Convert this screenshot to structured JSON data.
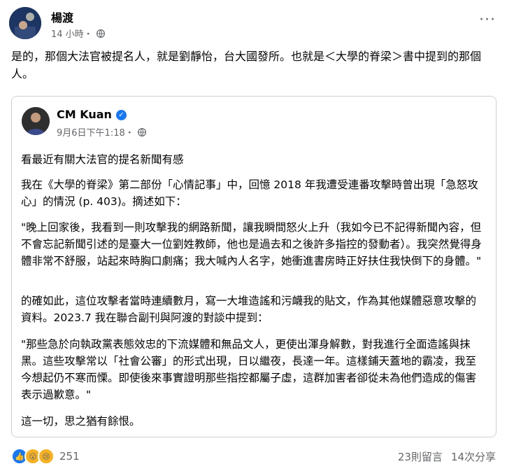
{
  "post": {
    "author": "楊渡",
    "time": "14 小時・",
    "text": "是的，那個大法官被提名人，就是劉靜怡，台大國發所。也就是＜大學的脊梁＞書中提到的那個人。"
  },
  "shared_post": {
    "author": "CM Kuan",
    "time": "9月6日下午1:18・",
    "paragraphs": [
      "看最近有關大法官的提名新聞有感",
      "我在《大學的脊梁》第二部份「心情記事」中，回憶 2018 年我遭受連番攻擊時曾出現「急怒攻心」的情況 (p. 403)。摘述如下：",
      "\"晚上回家後，我看到一則攻擊我的網路新聞，讓我瞬間怒火上升（我如今已不記得新聞內容，但不會忘記新聞引述的是臺大一位劉姓教師，他也是過去和之後許多指控的發動者）。我突然覺得身體非常不舒服，站起來時胸口劇痛；我大喊內人名字，她衝進書房時正好扶住我快倒下的身體。\"",
      "的確如此，這位攻擊者當時連續數月，寫一大堆造謠和污衊我的貼文，作為其他媒體惡意攻擊的資料。2023.7 我在聯合副刊與阿渡的對談中提到：",
      "\"那些急於向執政黨表態效忠的下流媒體和無品文人，更使出渾身解數，對我進行全面造謠與抹黑。這些攻擊常以「社會公審」的形式出現，日以繼夜，長達一年。這樣鋪天蓋地的霸凌，我至今想起仍不寒而慄。即使後來事實證明那些指控都屬子虛，這群加害者卻從未為他們造成的傷害表示過歉意。\"",
      "這一切，思之猶有餘恨。"
    ]
  },
  "footer": {
    "reaction_count": "251",
    "comments": "23則留言",
    "shares": "14次分享"
  },
  "icons": {
    "more": "more-options-icon",
    "globe": "globe-icon",
    "verified": "verified-badge-icon"
  },
  "colors": {
    "accent": "#1877f2",
    "secondary_text": "#65676b"
  }
}
